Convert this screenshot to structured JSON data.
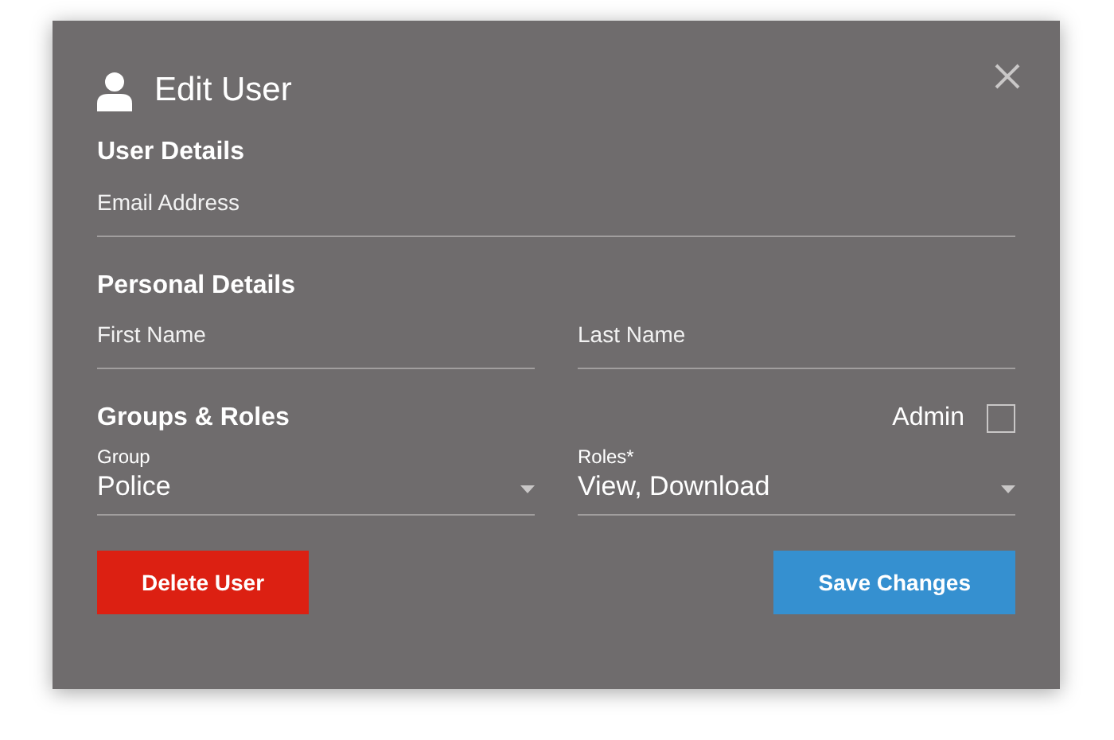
{
  "dialog": {
    "title": "Edit User"
  },
  "user_details": {
    "heading": "User Details",
    "email": {
      "placeholder": "Email Address"
    }
  },
  "personal_details": {
    "heading": "Personal Details",
    "first_name": {
      "placeholder": "First Name"
    },
    "last_name": {
      "placeholder": "Last Name"
    }
  },
  "groups_roles": {
    "heading": "Groups & Roles",
    "admin": {
      "label": "Admin",
      "checked": false
    },
    "selects": [
      {
        "label": "Group",
        "value": "Police"
      },
      {
        "label": "Roles*",
        "value": "View, Download"
      }
    ]
  },
  "buttons": [
    {
      "kind": "danger",
      "label": "Delete User"
    },
    {
      "kind": "primary",
      "label": "Save Changes"
    }
  ]
}
